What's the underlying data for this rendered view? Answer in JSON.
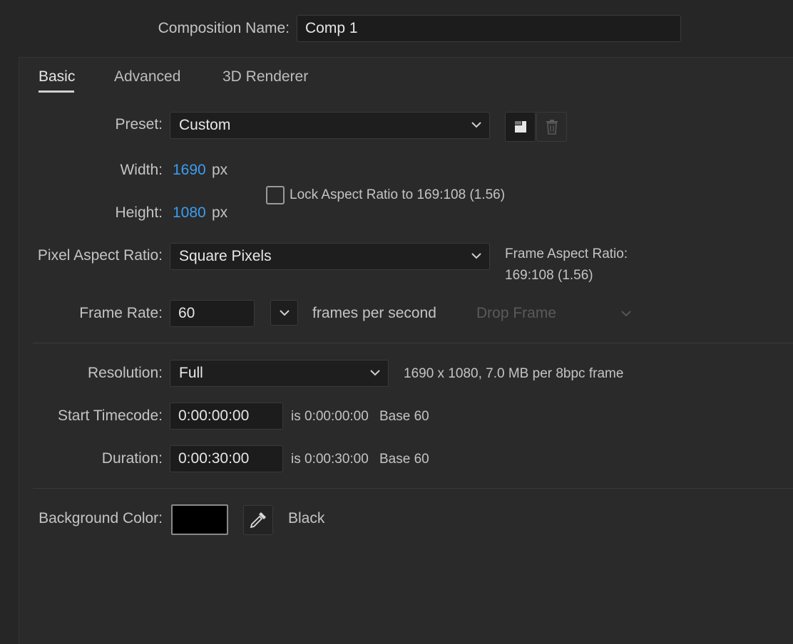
{
  "composition": {
    "name_label": "Composition Name:",
    "name_value": "Comp 1"
  },
  "tabs": [
    {
      "label": "Basic",
      "active": true
    },
    {
      "label": "Advanced",
      "active": false
    },
    {
      "label": "3D Renderer",
      "active": false
    }
  ],
  "preset": {
    "label": "Preset:",
    "value": "Custom",
    "save_icon": "save-preset-icon",
    "delete_icon": "trash-icon"
  },
  "dimensions": {
    "width_label": "Width:",
    "width_value": "1690",
    "height_label": "Height:",
    "height_value": "1080",
    "unit": "px",
    "lock_label": "Lock Aspect Ratio to 169:108 (1.56)",
    "lock_checked": false
  },
  "pixel_aspect": {
    "label": "Pixel Aspect Ratio:",
    "value": "Square Pixels",
    "frame_aspect_label": "Frame Aspect Ratio:",
    "frame_aspect_value": "169:108 (1.56)"
  },
  "frame_rate": {
    "label": "Frame Rate:",
    "value": "60",
    "unit": "frames per second",
    "drop_frame": "Drop Frame"
  },
  "resolution": {
    "label": "Resolution:",
    "value": "Full",
    "info": "1690 x 1080, 7.0 MB per 8bpc frame"
  },
  "start_timecode": {
    "label": "Start Timecode:",
    "value": "0:00:00:00",
    "info": "is 0:00:00:00",
    "base": "Base 60"
  },
  "duration": {
    "label": "Duration:",
    "value": "0:00:30:00",
    "info": "is 0:00:30:00",
    "base": "Base 60"
  },
  "background": {
    "label": "Background Color:",
    "color": "#000000",
    "name": "Black",
    "eyedropper_icon": "eyedropper-icon"
  },
  "colors": {
    "accent_blue": "#3d9df0",
    "background": "#262626"
  }
}
